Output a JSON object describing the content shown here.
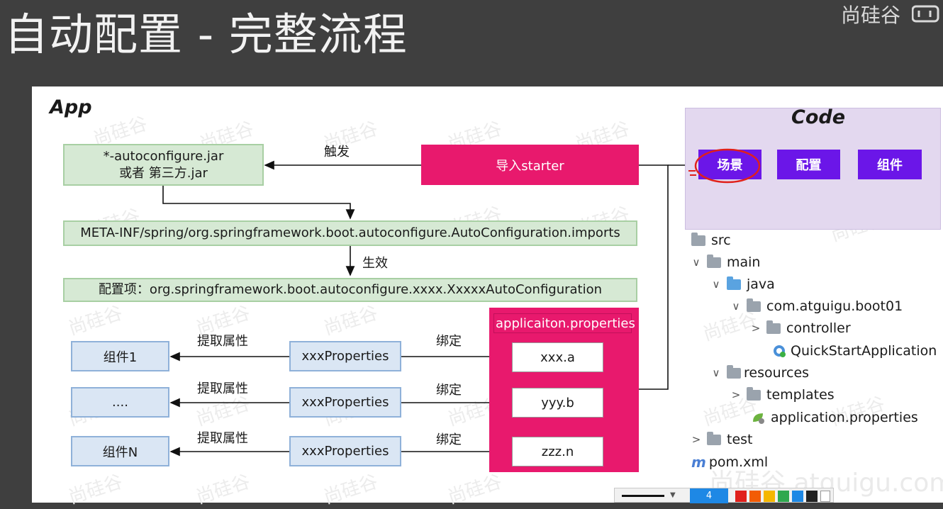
{
  "header": {
    "title": "自动配置 - 完整流程",
    "brand": "尚硅谷"
  },
  "app": {
    "label": "App",
    "jar_box": {
      "line1": "*-autoconfigure.jar",
      "line2": "或者  第三方.jar"
    },
    "trigger_label": "触发",
    "import_starter": "导入starter",
    "imports_file": "META-INF/spring/org.springframework.boot.autoconfigure.AutoConfiguration.imports",
    "effect_label": "生效",
    "config_item": "配置项：org.springframework.boot.autoconfigure.xxxx.XxxxxAutoConfiguration",
    "rows": [
      {
        "component": "组件1",
        "extract_label": "提取属性",
        "properties": "xxxProperties",
        "bind_label": "绑定",
        "value": "xxx.a"
      },
      {
        "component": "....",
        "extract_label": "提取属性",
        "properties": "xxxProperties",
        "bind_label": "绑定",
        "value": "yyy.b"
      },
      {
        "component": "组件N",
        "extract_label": "提取属性",
        "properties": "xxxProperties",
        "bind_label": "绑定",
        "value": "zzz.n"
      }
    ],
    "properties_panel_title": "applicaiton.properties"
  },
  "code": {
    "label": "Code",
    "buttons": [
      "场景",
      "配置",
      "组件"
    ],
    "tree": [
      {
        "label": "src",
        "chevron": "",
        "icon": "folder-icon"
      },
      {
        "label": "main",
        "chevron": "∨",
        "icon": "folder-icon"
      },
      {
        "label": "java",
        "chevron": "∨",
        "icon": "folder-blue-icon"
      },
      {
        "label": "com.atguigu.boot01",
        "chevron": "∨",
        "icon": "package-icon"
      },
      {
        "label": "controller",
        "chevron": ">",
        "icon": "package-icon"
      },
      {
        "label": "QuickStartApplication",
        "chevron": "",
        "icon": "spring-class-icon"
      },
      {
        "label": "resources",
        "chevron": "∨",
        "icon": "resources-folder-icon"
      },
      {
        "label": "templates",
        "chevron": ">",
        "icon": "folder-icon"
      },
      {
        "label": "application.properties",
        "chevron": "",
        "icon": "properties-file-icon"
      },
      {
        "label": "test",
        "chevron": ">",
        "icon": "folder-icon"
      },
      {
        "label": "pom.xml",
        "chevron": "",
        "icon": "maven-icon"
      }
    ]
  },
  "watermark": {
    "text": "尚硅谷",
    "footer": "尚硅谷 atguigu.com"
  },
  "toolbar": {
    "stroke_size": "4"
  },
  "colors": {
    "pink": "#e8196d",
    "purple": "#6b16e8",
    "green_fill": "#d6e9d4",
    "blue_fill": "#dae6f4",
    "code_panel": "#e3d8ef",
    "annotation_red": "#e0201b",
    "palette": [
      "#e0201b",
      "#f25c05",
      "#f5b700",
      "#2fa84f",
      "#1e88e5",
      "#222222",
      "#ffffff"
    ]
  }
}
